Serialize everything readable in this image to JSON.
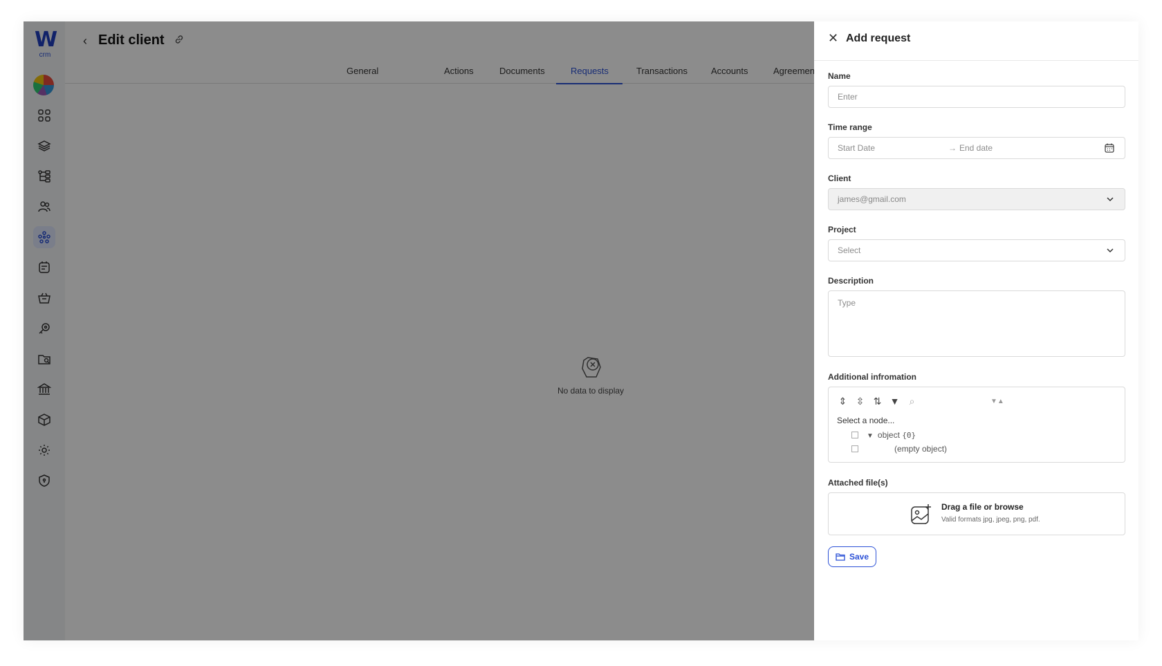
{
  "app": {
    "logo_letter": "W",
    "logo_sub": "crm"
  },
  "header": {
    "title": "Edit client"
  },
  "tabs": [
    {
      "label": "General"
    },
    {
      "label": "Actions"
    },
    {
      "label": "Documents"
    },
    {
      "label": "Requests",
      "active": true
    },
    {
      "label": "Transactions"
    },
    {
      "label": "Accounts"
    },
    {
      "label": "Agreements"
    }
  ],
  "empty_state": {
    "text": "No data to display"
  },
  "drawer": {
    "title": "Add request",
    "name": {
      "label": "Name",
      "placeholder": "Enter"
    },
    "time_range": {
      "label": "Time range",
      "start_placeholder": "Start Date",
      "separator": "→",
      "end_placeholder": "End date"
    },
    "client": {
      "label": "Client",
      "value": "james@gmail.com"
    },
    "project": {
      "label": "Project",
      "placeholder": "Select"
    },
    "description": {
      "label": "Description",
      "placeholder": "Type"
    },
    "additional": {
      "label": "Additional infromation",
      "select_node": "Select a node...",
      "root_key": "object",
      "root_count": "{0}",
      "empty_text": "(empty object)"
    },
    "attached": {
      "label": "Attached file(s)",
      "title": "Drag a file or browse",
      "subtitle": "Valid formats jpg, jpeg, png, pdf."
    },
    "save_label": "Save"
  },
  "colors": {
    "accent": "#2b50d6",
    "overlay": "rgba(0,0,0,0.45)"
  }
}
